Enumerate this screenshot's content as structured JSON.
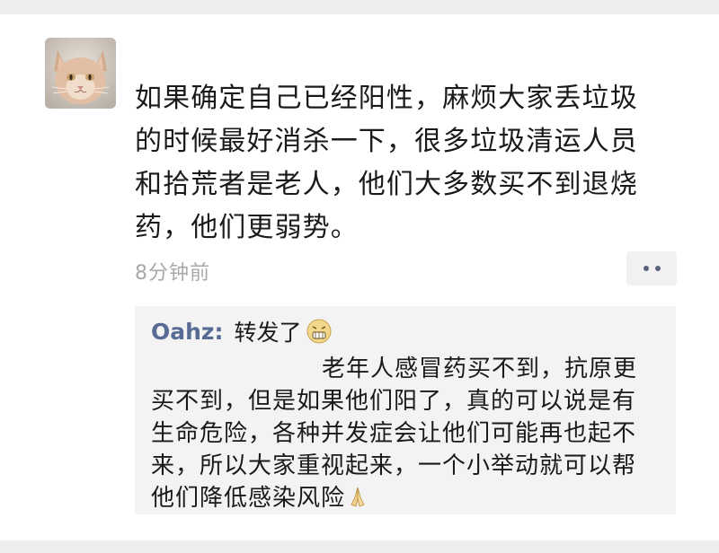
{
  "post": {
    "author_avatar": "cat-photo",
    "text_lines": [
      "如果确定自己已经阳性，麻烦大家丢垃圾",
      "的时候最好消杀一下，很多垃圾清运人员",
      "和拾荒者是老人，他们大多数买不到退烧",
      "药，他们更弱势。"
    ],
    "timestamp": "8分钟前",
    "more_icon": "more-dots-icon"
  },
  "comment": {
    "author": "Oahz",
    "separator": ":",
    "intro": "转发了",
    "intro_emoji": "grimace-face-icon",
    "body_lines": [
      "老年人感冒药买不到，抗原更",
      "买不到，但是如果他们阳了，真的可以说是有",
      "生命危险，各种并发症会让他们可能再也起不",
      "来，所以大家重视起来，一个小举动就可以帮",
      "他们降低感染风险"
    ],
    "end_emoji": "praying-hands-icon"
  },
  "colors": {
    "link_blue": "#576b95",
    "text": "#1a1a1a",
    "muted": "#a8a8a8",
    "comment_bg": "#f3f3f3"
  }
}
